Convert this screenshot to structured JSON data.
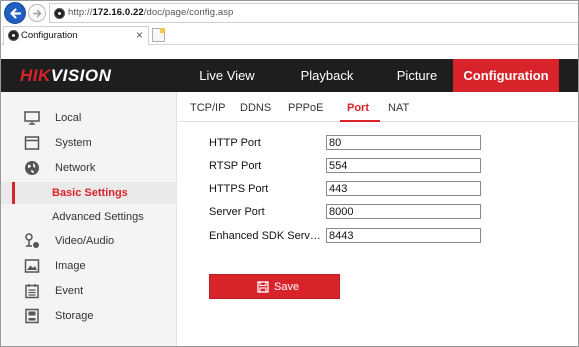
{
  "browser": {
    "url_prefix": "http://",
    "url_host": "172.16.0.22",
    "url_path": "/doc/page/config.asp",
    "tab_title": "Configuration",
    "tab_close": "×"
  },
  "brand": {
    "logo_part1": "HIK",
    "logo_part2": "VISION",
    "accent_color": "#d9232a"
  },
  "topnav": [
    {
      "label": "Live View"
    },
    {
      "label": "Playback"
    },
    {
      "label": "Picture"
    },
    {
      "label": "Configuration"
    }
  ],
  "sidebar": {
    "items": [
      {
        "label": "Local",
        "icon": "monitor-icon"
      },
      {
        "label": "System",
        "icon": "system-icon"
      },
      {
        "label": "Network",
        "icon": "globe-icon"
      },
      {
        "label": "Basic Settings"
      },
      {
        "label": "Advanced Settings"
      },
      {
        "label": "Video/Audio",
        "icon": "video-audio-icon"
      },
      {
        "label": "Image",
        "icon": "image-icon"
      },
      {
        "label": "Event",
        "icon": "event-icon"
      },
      {
        "label": "Storage",
        "icon": "storage-icon"
      }
    ]
  },
  "subtabs": [
    {
      "label": "TCP/IP"
    },
    {
      "label": "DDNS"
    },
    {
      "label": "PPPoE"
    },
    {
      "label": "Port"
    },
    {
      "label": "NAT"
    }
  ],
  "form": {
    "rows": [
      {
        "label": "HTTP Port",
        "value": "80"
      },
      {
        "label": "RTSP Port",
        "value": "554"
      },
      {
        "label": "HTTPS Port",
        "value": "443"
      },
      {
        "label": "Server Port",
        "value": "8000"
      },
      {
        "label": "Enhanced SDK Service P...",
        "value": "8443"
      }
    ],
    "save_label": "Save"
  }
}
